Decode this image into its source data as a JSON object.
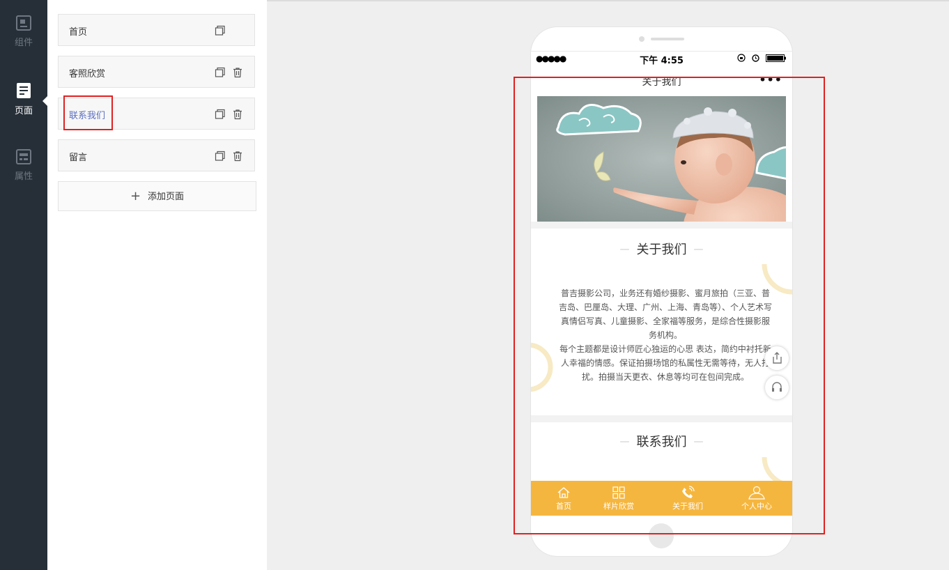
{
  "rail": {
    "items": [
      {
        "label": "组件",
        "icon": "component-icon"
      },
      {
        "label": "页面",
        "icon": "page-icon"
      },
      {
        "label": "属性",
        "icon": "property-icon"
      }
    ]
  },
  "pages": {
    "items": [
      {
        "label": "首页"
      },
      {
        "label": "客照欣赏"
      },
      {
        "label": "联系我们"
      },
      {
        "label": "留言"
      }
    ],
    "add_label": "添加页面"
  },
  "phone": {
    "status": {
      "signal": "●●●●●",
      "time": "下午 4:55"
    },
    "nav_title": "关于我们",
    "nav_more": "•••",
    "about": {
      "title": "关于我们",
      "paragraphs": [
        "普吉摄影公司，业务还有婚纱摄影、蜜月旅拍（三亚、普吉岛、巴厘岛、大理、广州、上海、青岛等）、个人艺术写真情侣写真、儿童摄影、全家福等服务，是综合性摄影服务机构。",
        "每个主题都是设计师匠心独运的心思 表达，简约中衬托新人幸福的情感。保证拍摄场馆的私属性无需等待，无人打扰。拍摄当天更衣、休息等均可在包间完成。"
      ]
    },
    "contact": {
      "title": "联系我们"
    },
    "tabs": [
      {
        "label": "首页",
        "icon": "home-icon"
      },
      {
        "label": "样片欣赏",
        "icon": "grid-icon"
      },
      {
        "label": "关于我们",
        "icon": "phone-call-icon"
      },
      {
        "label": "个人中心",
        "icon": "user-icon"
      }
    ],
    "colors": {
      "tabbar": "#f5b63f",
      "accent": "#5a6fc2",
      "highlight": "#e02020"
    }
  }
}
